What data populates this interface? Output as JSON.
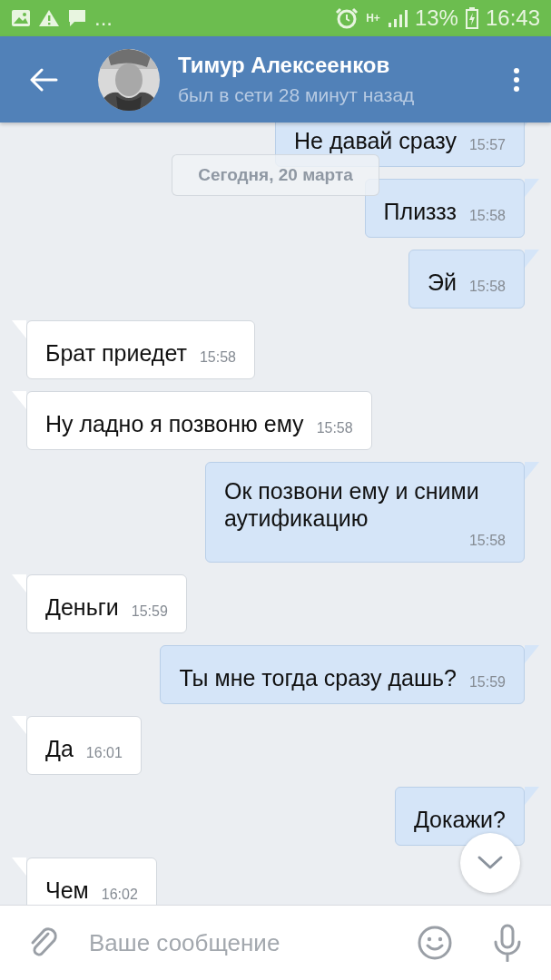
{
  "status_bar": {
    "more": "...",
    "network": "H+",
    "battery": "13%",
    "time": "16:43"
  },
  "header": {
    "name": "Тимур Алексеенков",
    "last_seen": "был в сети 28 минут назад"
  },
  "date_chip": "Сегодня, 20 марта",
  "messages": [
    {
      "outgoing": true,
      "text": "Не давай сразу",
      "time": "15:57"
    },
    {
      "outgoing": true,
      "text": "Плиззз",
      "time": "15:58"
    },
    {
      "outgoing": true,
      "text": "Эй",
      "time": "15:58"
    },
    {
      "outgoing": false,
      "text": "Брат приедет",
      "time": "15:58"
    },
    {
      "outgoing": false,
      "text": "Ну ладно я позвоню ему",
      "time": "15:58"
    },
    {
      "outgoing": true,
      "text": "Ок позвони ему и сними аутификацию",
      "time": "15:58"
    },
    {
      "outgoing": false,
      "text": "Деньги",
      "time": "15:59"
    },
    {
      "outgoing": true,
      "text": "Ты мне тогда сразу дашь?",
      "time": "15:59"
    },
    {
      "outgoing": false,
      "text": "Да",
      "time": "16:01"
    },
    {
      "outgoing": true,
      "text": "Докажи?"
    },
    {
      "outgoing": false,
      "text": "Чем",
      "time": "16:02"
    }
  ],
  "composer": {
    "placeholder": "Ваше сообщение"
  }
}
